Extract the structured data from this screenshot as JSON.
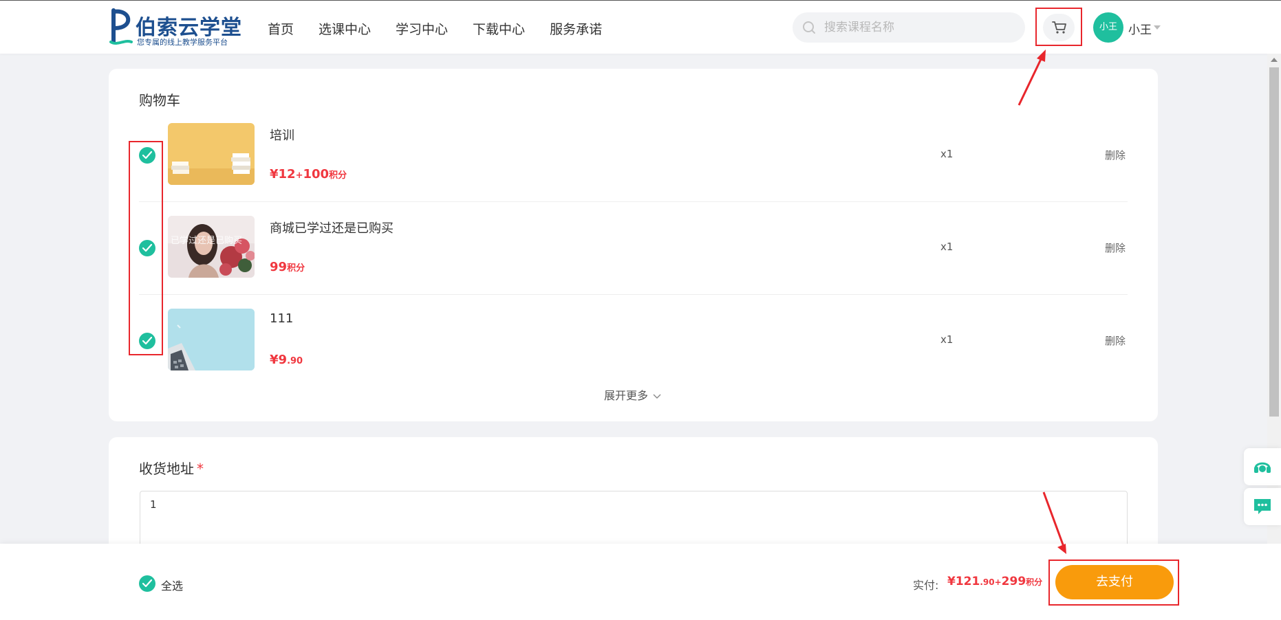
{
  "header": {
    "logo_title": "伯索云学堂",
    "logo_subtitle": "您专属的线上教学服务平台",
    "nav": [
      "首页",
      "选课中心",
      "学习中心",
      "下载中心",
      "服务承诺"
    ],
    "search_placeholder": "搜索课程名称",
    "avatar_text": "小王",
    "username": "小王"
  },
  "cart": {
    "title": "购物车",
    "items": [
      {
        "name": "培训",
        "price_parts": [
          "¥12",
          "+",
          "100",
          "积分"
        ],
        "qty": "x1",
        "delete_label": "删除",
        "thumb": "orange-books"
      },
      {
        "name": "商城已学过还是已购买",
        "price_parts": [
          "99",
          "积分"
        ],
        "qty": "x1",
        "delete_label": "删除",
        "thumb": "portrait-flowers",
        "thumb_overlay": "已学过还是已购买"
      },
      {
        "name": "111",
        "price_parts": [
          "¥9",
          ".90"
        ],
        "qty": "x1",
        "delete_label": "删除",
        "thumb": "laptop-blue"
      }
    ],
    "expand_label": "展开更多"
  },
  "address": {
    "title": "收货地址",
    "required_mark": "*",
    "value": "1"
  },
  "footer": {
    "select_all_label": "全选",
    "total_label": "实付:",
    "total_parts": [
      "¥121",
      ".90",
      "+",
      "299",
      "积分"
    ],
    "pay_label": "去支付"
  },
  "colors": {
    "accent_teal": "#1fbf9e",
    "price_red": "#f0373f",
    "pay_orange": "#f99b0c",
    "annotation_red": "#e8262c"
  },
  "icons": [
    "search-icon",
    "cart-icon",
    "check-icon",
    "chevron-down-icon",
    "headset-icon",
    "chat-icon"
  ]
}
